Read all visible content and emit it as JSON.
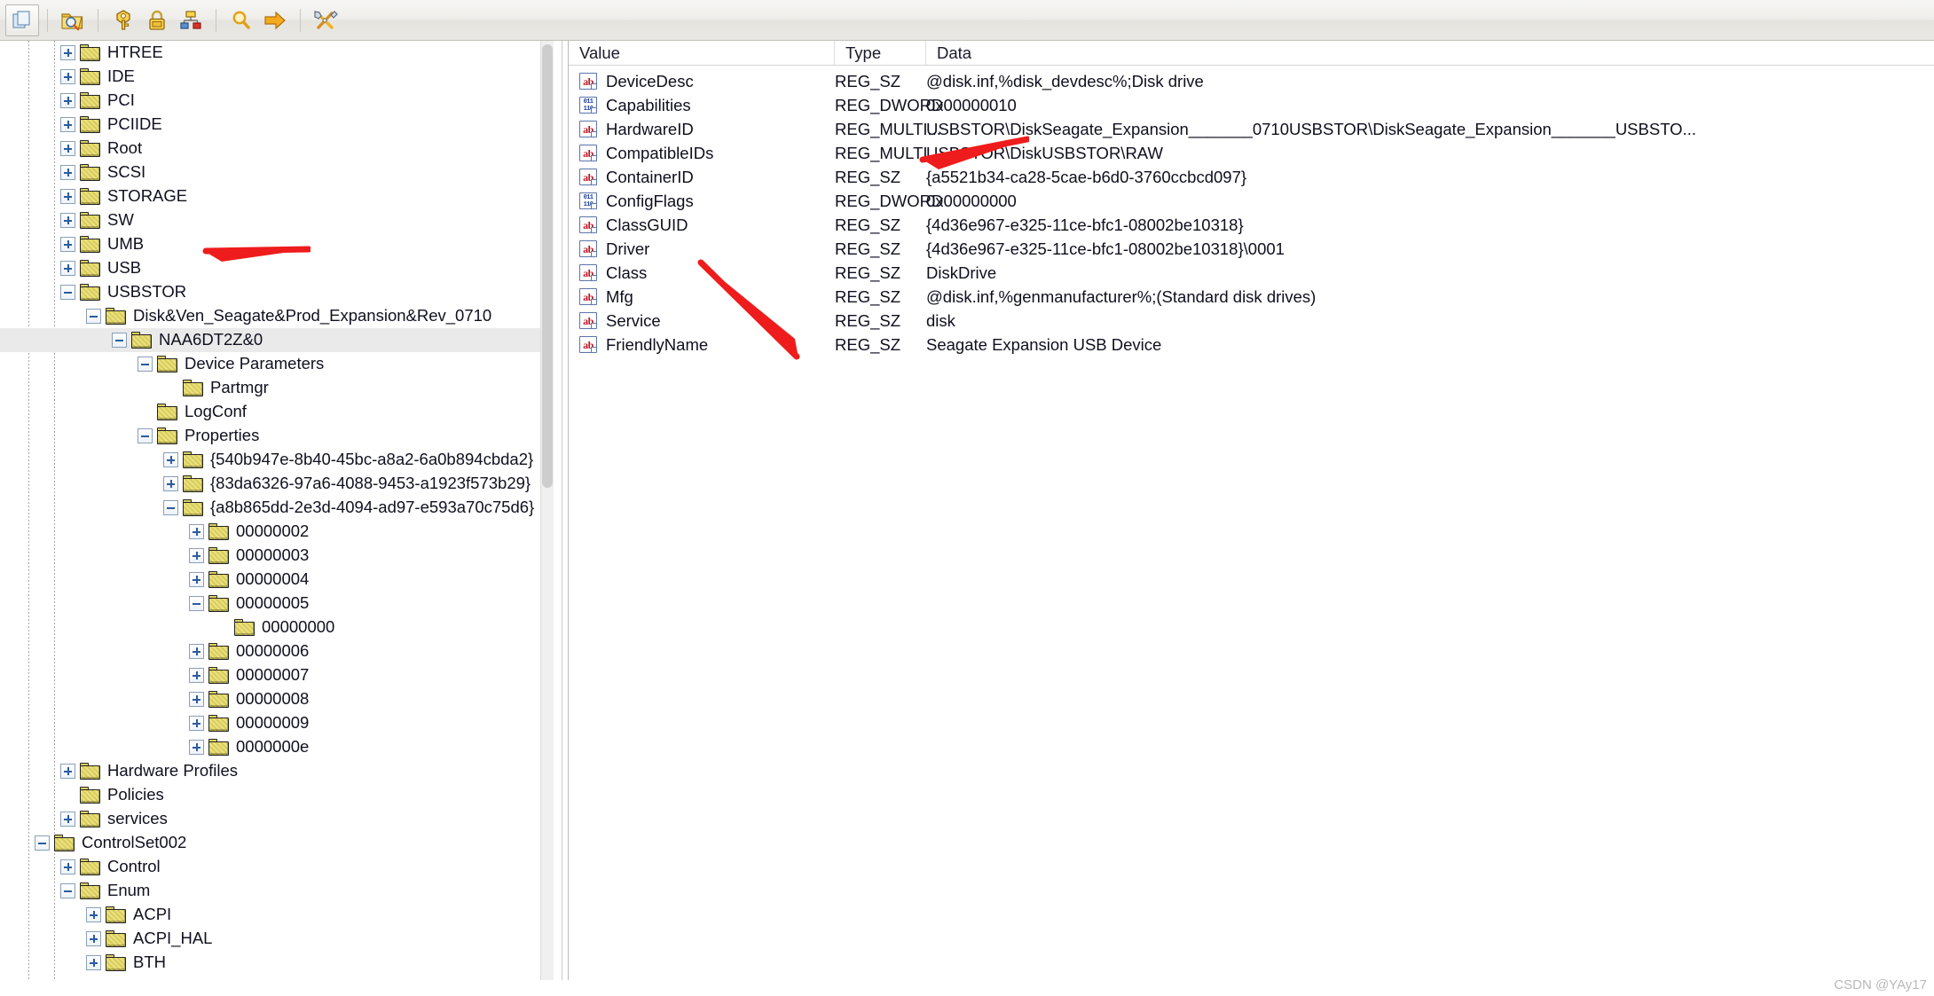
{
  "toolbar": {
    "buttons": [
      {
        "name": "copy-icon",
        "title": "Copy"
      },
      {
        "name": "find-folder-icon",
        "title": "Find in folder"
      },
      {
        "name": "key-icon",
        "title": "Key"
      },
      {
        "name": "lock-icon",
        "title": "Permissions"
      },
      {
        "name": "network-icon",
        "title": "Connect network registry"
      },
      {
        "name": "search-icon",
        "title": "Search"
      },
      {
        "name": "go-arrow-icon",
        "title": "Go to"
      },
      {
        "name": "tools-icon",
        "title": "Tools"
      }
    ]
  },
  "tree": {
    "selected_key": "NAA6DT2Z&0",
    "nodes": [
      {
        "label": "HTREE",
        "depth": 2,
        "state": "plus",
        "id": "htree"
      },
      {
        "label": "IDE",
        "depth": 2,
        "state": "plus",
        "id": "ide"
      },
      {
        "label": "PCI",
        "depth": 2,
        "state": "plus",
        "id": "pci"
      },
      {
        "label": "PCIIDE",
        "depth": 2,
        "state": "plus",
        "id": "pciide"
      },
      {
        "label": "Root",
        "depth": 2,
        "state": "plus",
        "id": "root"
      },
      {
        "label": "SCSI",
        "depth": 2,
        "state": "plus",
        "id": "scsi"
      },
      {
        "label": "STORAGE",
        "depth": 2,
        "state": "plus",
        "id": "storage"
      },
      {
        "label": "SW",
        "depth": 2,
        "state": "plus",
        "id": "sw"
      },
      {
        "label": "UMB",
        "depth": 2,
        "state": "plus",
        "id": "umb"
      },
      {
        "label": "USB",
        "depth": 2,
        "state": "plus",
        "id": "usb"
      },
      {
        "label": "USBSTOR",
        "depth": 2,
        "state": "minus",
        "id": "usbstor"
      },
      {
        "label": "Disk&Ven_Seagate&Prod_Expansion&Rev_0710",
        "depth": 3,
        "state": "minus",
        "id": "disk-ven-seagate"
      },
      {
        "label": "NAA6DT2Z&0",
        "depth": 4,
        "state": "minus",
        "id": "naa6dt2z",
        "selected": true
      },
      {
        "label": "Device Parameters",
        "depth": 5,
        "state": "minus",
        "id": "device-parameters"
      },
      {
        "label": "Partmgr",
        "depth": 6,
        "state": "none",
        "id": "partmgr"
      },
      {
        "label": "LogConf",
        "depth": 5,
        "state": "none",
        "id": "logconf"
      },
      {
        "label": "Properties",
        "depth": 5,
        "state": "minus",
        "id": "properties"
      },
      {
        "label": "{540b947e-8b40-45bc-a8a2-6a0b894cbda2}",
        "depth": 6,
        "state": "plus",
        "id": "guid-540b947e"
      },
      {
        "label": "{83da6326-97a6-4088-9453-a1923f573b29}",
        "depth": 6,
        "state": "plus",
        "id": "guid-83da6326"
      },
      {
        "label": "{a8b865dd-2e3d-4094-ad97-e593a70c75d6}",
        "depth": 6,
        "state": "minus",
        "id": "guid-a8b865dd"
      },
      {
        "label": "00000002",
        "depth": 7,
        "state": "plus",
        "id": "prop-00000002"
      },
      {
        "label": "00000003",
        "depth": 7,
        "state": "plus",
        "id": "prop-00000003"
      },
      {
        "label": "00000004",
        "depth": 7,
        "state": "plus",
        "id": "prop-00000004"
      },
      {
        "label": "00000005",
        "depth": 7,
        "state": "minus",
        "id": "prop-00000005"
      },
      {
        "label": "00000000",
        "depth": 8,
        "state": "none",
        "id": "prop-00000000"
      },
      {
        "label": "00000006",
        "depth": 7,
        "state": "plus",
        "id": "prop-00000006"
      },
      {
        "label": "00000007",
        "depth": 7,
        "state": "plus",
        "id": "prop-00000007"
      },
      {
        "label": "00000008",
        "depth": 7,
        "state": "plus",
        "id": "prop-00000008"
      },
      {
        "label": "00000009",
        "depth": 7,
        "state": "plus",
        "id": "prop-00000009"
      },
      {
        "label": "0000000e",
        "depth": 7,
        "state": "plus",
        "id": "prop-0000000e"
      },
      {
        "label": "Hardware Profiles",
        "depth": 2,
        "state": "plus",
        "id": "hardware-profiles"
      },
      {
        "label": "Policies",
        "depth": 2,
        "state": "none",
        "id": "policies"
      },
      {
        "label": "services",
        "depth": 2,
        "state": "plus",
        "id": "services"
      },
      {
        "label": "ControlSet002",
        "depth": 1,
        "state": "minus",
        "id": "controlset002"
      },
      {
        "label": "Control",
        "depth": 2,
        "state": "plus",
        "id": "control"
      },
      {
        "label": "Enum",
        "depth": 2,
        "state": "minus",
        "id": "enum"
      },
      {
        "label": "ACPI",
        "depth": 3,
        "state": "plus",
        "id": "acpi"
      },
      {
        "label": "ACPI_HAL",
        "depth": 3,
        "state": "plus",
        "id": "acpi-hal"
      },
      {
        "label": "BTH",
        "depth": 3,
        "state": "plus",
        "id": "bth"
      }
    ]
  },
  "list": {
    "columns": [
      "Value",
      "Type",
      "Data"
    ],
    "rows": [
      {
        "icon": "sz",
        "value": "DeviceDesc",
        "type": "REG_SZ",
        "data": "@disk.inf,%disk_devdesc%;Disk drive"
      },
      {
        "icon": "bin",
        "value": "Capabilities",
        "type": "REG_DWORD",
        "data": "0x00000010"
      },
      {
        "icon": "sz",
        "value": "HardwareID",
        "type": "REG_MULTI...",
        "data": "USBSTOR\\DiskSeagate_Expansion_______0710USBSTOR\\DiskSeagate_Expansion_______USBSTO..."
      },
      {
        "icon": "sz",
        "value": "CompatibleIDs",
        "type": "REG_MULTI...",
        "data": "USBSTOR\\DiskUSBSTOR\\RAW"
      },
      {
        "icon": "sz",
        "value": "ContainerID",
        "type": "REG_SZ",
        "data": "{a5521b34-ca28-5cae-b6d0-3760ccbcd097}"
      },
      {
        "icon": "bin",
        "value": "ConfigFlags",
        "type": "REG_DWORD",
        "data": "0x00000000"
      },
      {
        "icon": "sz",
        "value": "ClassGUID",
        "type": "REG_SZ",
        "data": "{4d36e967-e325-11ce-bfc1-08002be10318}"
      },
      {
        "icon": "sz",
        "value": "Driver",
        "type": "REG_SZ",
        "data": "{4d36e967-e325-11ce-bfc1-08002be10318}\\0001"
      },
      {
        "icon": "sz",
        "value": "Class",
        "type": "REG_SZ",
        "data": "DiskDrive"
      },
      {
        "icon": "sz",
        "value": "Mfg",
        "type": "REG_SZ",
        "data": "@disk.inf,%genmanufacturer%;(Standard disk drives)"
      },
      {
        "icon": "sz",
        "value": "Service",
        "type": "REG_SZ",
        "data": "disk"
      },
      {
        "icon": "sz",
        "value": "FriendlyName",
        "type": "REG_SZ",
        "data": "Seagate Expansion USB Device"
      }
    ]
  },
  "annotations": {
    "arrow_color": "#ee1c1c",
    "arrows": [
      {
        "name": "arrow-classguid",
        "target": "ClassGUID data value"
      },
      {
        "name": "arrow-tree-key",
        "target": "NAA6DT2Z&0 tree key"
      },
      {
        "name": "arrow-friendlyname",
        "target": "FriendlyName data value"
      }
    ]
  },
  "watermark": {
    "text": "CSDN @YAy17"
  }
}
